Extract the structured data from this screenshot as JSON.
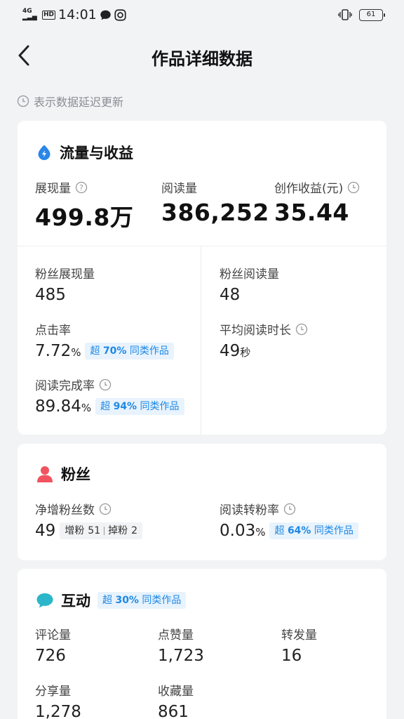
{
  "status_bar": {
    "network": "4G",
    "hd": "HD",
    "time": "14:01",
    "battery": "61"
  },
  "header": {
    "title": "作品详细数据"
  },
  "notice": {
    "text": "表示数据延迟更新"
  },
  "traffic": {
    "title": "流量与收益",
    "impressions": {
      "label": "展现量",
      "value": "499.8万"
    },
    "reads": {
      "label": "阅读量",
      "value": "386,252"
    },
    "income": {
      "label": "创作收益(元)",
      "value": "35.44"
    },
    "fan_impressions": {
      "label": "粉丝展现量",
      "value": "485"
    },
    "fan_reads": {
      "label": "粉丝阅读量",
      "value": "48"
    },
    "ctr": {
      "label": "点击率",
      "value": "7.72",
      "unit": "%",
      "badge_prefix": "超",
      "badge_pct": "70%",
      "badge_suffix": "同类作品"
    },
    "avg_read_time": {
      "label": "平均阅读时长",
      "value": "49",
      "unit": "秒"
    },
    "completion": {
      "label": "阅读完成率",
      "value": "89.84",
      "unit": "%",
      "badge_prefix": "超",
      "badge_pct": "94%",
      "badge_suffix": "同类作品"
    }
  },
  "fans": {
    "title": "粉丝",
    "net_growth": {
      "label": "净增粉丝数",
      "value": "49",
      "gain_label": "增粉",
      "gain": "51",
      "loss_label": "掉粉",
      "loss": "2"
    },
    "conversion": {
      "label": "阅读转粉率",
      "value": "0.03",
      "unit": "%",
      "badge_prefix": "超",
      "badge_pct": "64%",
      "badge_suffix": "同类作品"
    }
  },
  "interaction": {
    "title": "互动",
    "badge_prefix": "超",
    "badge_pct": "30%",
    "badge_suffix": "同类作品",
    "comments": {
      "label": "评论量",
      "value": "726"
    },
    "likes": {
      "label": "点赞量",
      "value": "1,723"
    },
    "reposts": {
      "label": "转发量",
      "value": "16"
    },
    "shares": {
      "label": "分享量",
      "value": "1,278"
    },
    "favorites": {
      "label": "收藏量",
      "value": "861"
    }
  },
  "colors": {
    "accent": "#1e88e5",
    "fan_icon": "#f0535f",
    "chat_icon": "#2bb6c9",
    "background": "#f2f3f5"
  }
}
